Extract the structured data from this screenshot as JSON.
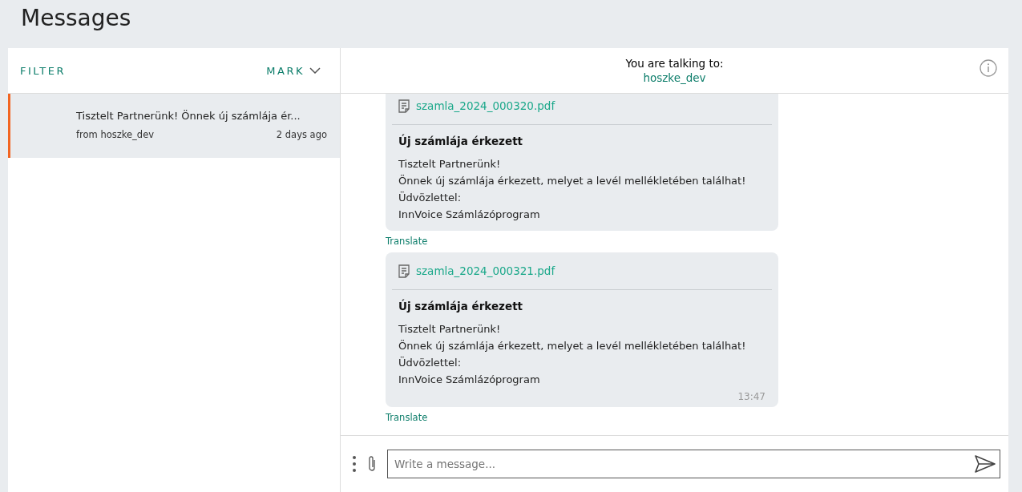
{
  "page_title": "Messages",
  "list_header": {
    "filter": "FILTER",
    "mark": "MARK"
  },
  "conversations": [
    {
      "preview": "Tisztelt Partnerünk! Önnek új számlája ér...",
      "from": "from hoszke_dev",
      "time": "2 days ago",
      "selected": true
    }
  ],
  "chat_header": {
    "label": "You are talking to:",
    "contact": "hoszke_dev"
  },
  "messages": [
    {
      "attachment": "szamla_2024_000320.pdf",
      "title": "Új számlája érkezett",
      "lines": [
        "Tisztelt Partnerünk!",
        "Önnek új számlája érkezett, melyet a levél mellékletében találhat!",
        "Üdvözlettel:",
        "InnVoice Számlázóprogram"
      ],
      "translate": "Translate"
    },
    {
      "attachment": "szamla_2024_000321.pdf",
      "title": "Új számlája érkezett",
      "lines": [
        "Tisztelt Partnerünk!",
        "Önnek új számlája érkezett, melyet a levél mellékletében találhat!",
        "Üdvözlettel:",
        "InnVoice Számlázóprogram"
      ],
      "time": "13:47",
      "translate": "Translate"
    }
  ],
  "composer": {
    "placeholder": "Write a message..."
  }
}
